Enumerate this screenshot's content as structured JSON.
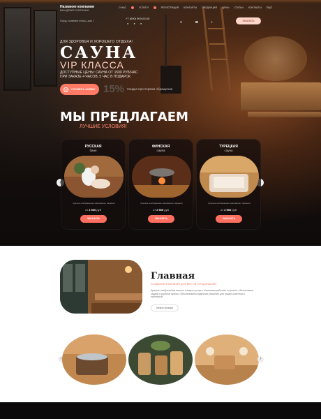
{
  "header": {
    "company_name": "Название компании",
    "company_tagline": "ВАШ ДЕВИЗ КОМПАНИИ",
    "nav": [
      "О НАС",
      "УСЛУГИ",
      "РЕГИСТРАЦИЯ",
      "КОНТАКТЫ",
      "ПРОДУКЦИЯ",
      "ЦЕНЫ",
      "СТАТЬИ",
      "КОНТАКТЫ",
      "ЕЩЁ"
    ],
    "phone": "+7 (000) 000-00-00",
    "address": "Город, название улицы, дом 1",
    "call_button": "ЗАКАЗАТЬ"
  },
  "hero": {
    "kicker": "ДЛЯ ЗДОРОВЬЯ И ХОРОШЕГО ОТДЫХА!",
    "title": "САУНА",
    "subtitle": "VIP КЛАССА",
    "promo_line1": "ДОСТУПНЫЕ ЦЕНЫ: САУНА ОТ 1500 РУБ/ЧАС",
    "promo_line2": "ПРИ ЗАКАЗЕ 4 ЧАСОВ, 5 ЧАС В ПОДАРОК",
    "cta_label": "ОСТАВИТЬ ЗАЯВКУ",
    "discount": "15%",
    "discount_note": "Скидка при первом обращении"
  },
  "offer": {
    "title": "МЫ ПРЕДЛАГАЕМ",
    "subtitle": "ЛУЧШИЕ УСЛОВИЯ!"
  },
  "cards": [
    {
      "title": "РУССКАЯ",
      "sub": "баня",
      "desc": "Краткое изображение массажного парения",
      "price_prefix": "от",
      "price": "2 500",
      "currency": "руб",
      "button": "ЗАКАЗАТЬ"
    },
    {
      "title": "ФИНСКАЯ",
      "sub": "сауна",
      "desc": "Краткое изображение массажного парения",
      "price_prefix": "от",
      "price": "2 500",
      "currency": "руб",
      "button": "ЗАКАЗАТЬ"
    },
    {
      "title": "ТУРЕЦКАЯ",
      "sub": "сауна",
      "desc": "Краткое изображение массажного парения",
      "price_prefix": "от",
      "price": "2 500",
      "currency": "руб",
      "button": "ЗАКАЗАТЬ"
    }
  ],
  "about": {
    "title": "Главная",
    "subtitle": "Создание компании для вас на сегодняшний",
    "text": "Краткое изображение вашего товара и услуги. Компания работает на рынке, обеспечивая задачи в удобное время. Обеспечиваем надёжное решение для наших клиентов и партнёров.",
    "button": "Узнать больше"
  },
  "colors": {
    "accent": "#ff6f60",
    "accent_light": "#ff8a72"
  }
}
